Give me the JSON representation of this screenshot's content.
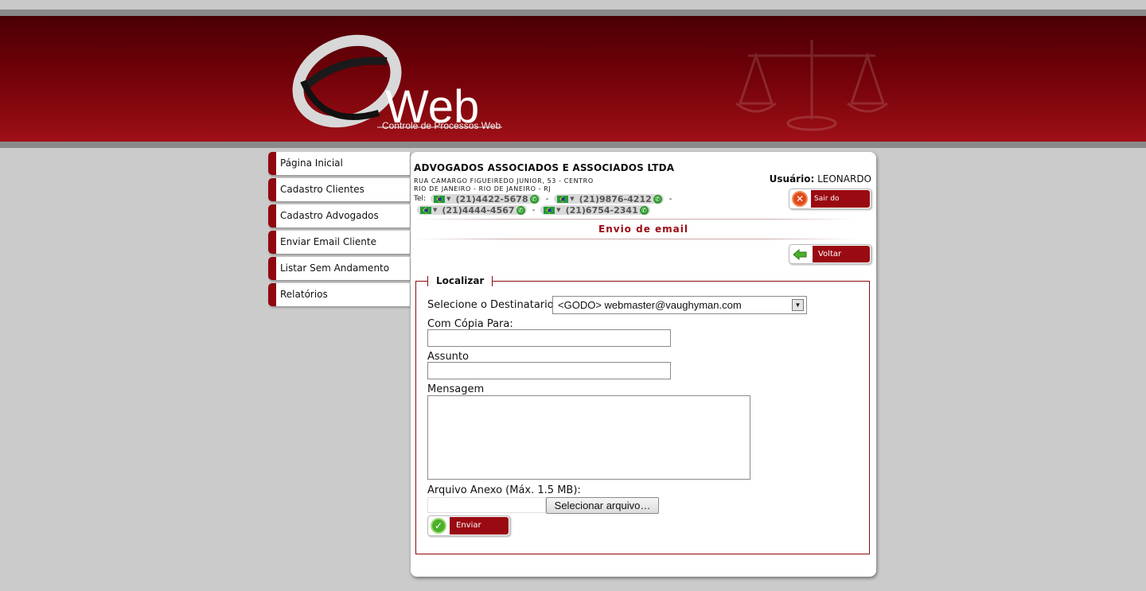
{
  "colors": {
    "brand": "#8e0a10",
    "banner_dark": "#4a0004",
    "page_bg": "#cbcbcb"
  },
  "header": {
    "logo_text": "Web",
    "logo_subtitle": "Controle de Processos Web"
  },
  "sidebar": {
    "items": [
      {
        "label": "Página Inicial"
      },
      {
        "label": "Cadastro Clientes"
      },
      {
        "label": "Cadastro Advogados"
      },
      {
        "label": "Enviar Email Cliente"
      },
      {
        "label": "Listar Sem Andamento"
      },
      {
        "label": "Relatórios"
      }
    ]
  },
  "company": {
    "name": "ADVOGADOS ASSOCIADOS E ASSOCIADOS LTDA",
    "address_line1": "RUA CAMARGO FIGUEIREDO JUNIOR, 53 - CENTRO",
    "address_line2": "RIO DE JANEIRO - RIO DE JANEIRO - RJ",
    "tel_label": "Tel:",
    "separator": "-",
    "phones": [
      "(21)4422-5678",
      "(21)9876-4212",
      "(21)4444-4567",
      "(21)6754-2341"
    ]
  },
  "user": {
    "label": "Usuário:",
    "name": "LEONARDO",
    "logout_label": "Sair do Sistema"
  },
  "page": {
    "title": "Envio de email",
    "back_label": "Voltar"
  },
  "form": {
    "legend": "Localizar",
    "recipient_label": "Selecione o Destinatario",
    "recipient_value": "<GODO> webmaster@vaughyman.com",
    "cc_label": "Com Cópia Para:",
    "cc_value": "",
    "subject_label": "Assunto",
    "subject_value": "",
    "message_label": "Mensagem",
    "attachment_label": "Arquivo Anexo (Máx. 1.5 MB):",
    "file_button_label": "Selecionar arquivo…",
    "send_label": "Enviar"
  }
}
